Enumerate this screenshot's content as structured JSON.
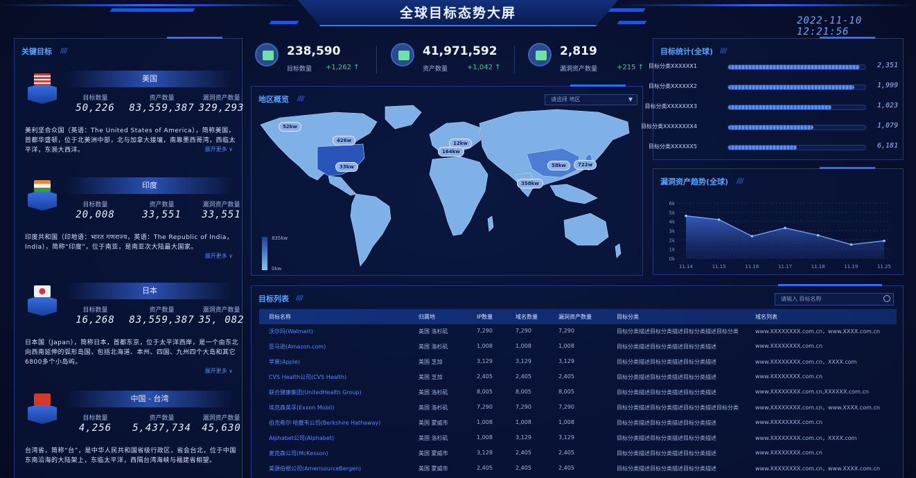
{
  "header": {
    "title": "全球目标态势大屏",
    "datetime": "2022-11-10  12:21:56"
  },
  "left_panel": {
    "title": "关键目标",
    "targets": [
      {
        "name": "美国",
        "flag_color": "#b8413f",
        "labels": [
          "目标数量",
          "资产数量",
          "漏洞资产数量"
        ],
        "values": [
          "50,226",
          "83,559,387",
          "329,293"
        ],
        "desc": "美利坚合众国（英语：The United States of America），简称美国，首都华盛顿，位于北美洲中部，北与加拿大接壤，南靠墨西哥湾，西临太平洋，东濒大西洋。",
        "more": "展开更多 ∨"
      },
      {
        "name": "印度",
        "flag_color": "#e08a3a",
        "labels": [
          "目标数量",
          "资产数量",
          "漏洞资产数量"
        ],
        "values": [
          "20,008",
          "33,551",
          "33,551"
        ],
        "desc": "印度共和国（印地语：भारत गणराज्य，英语：The Republic of India，India），简称“印度”，位于南亚，是南亚次大陆最大国家。",
        "more": "展开更多 ∨"
      },
      {
        "name": "日本",
        "flag_color": "#cfd6e6",
        "labels": [
          "目标数量",
          "资产数量",
          "漏洞资产数量"
        ],
        "values": [
          "16,268",
          "83,559,387",
          "35, 082"
        ],
        "desc": "日本国（Japan），简称日本，首都东京，位于太平洋西岸，是一个由东北向西南延伸的弧形岛国，包括北海道、本州、四国、九州四个大岛和其它6800多个小岛屿。",
        "more": "展开更多 ∨"
      },
      {
        "name": "中国 - 台湾",
        "flag_color": "#d23a2c",
        "labels": [
          "目标数量",
          "资产数量",
          "漏洞资产数量"
        ],
        "values": [
          "4,256",
          "5,437,734",
          "45,630"
        ],
        "desc": "台湾省，简称“台”，是中华人民共和国省级行政区，省会台北，位于中国东南沿海的大陆架上，东临太平洋，西隔台湾海峡与福建省相望。",
        "more": ""
      }
    ]
  },
  "kpis": [
    {
      "value": "238,590",
      "label": "目标数量",
      "delta": "+1,262 ↑",
      "icon": "target-icon"
    },
    {
      "value": "41,971,592",
      "label": "资产数量",
      "delta": "+1,042 ↑",
      "icon": "asset-icon"
    },
    {
      "value": "2,819",
      "label": "漏洞资产数量",
      "delta": "+215 ↑",
      "icon": "vuln-icon"
    }
  ],
  "map": {
    "title": "地区概览",
    "select_placeholder": "请选择 地区",
    "legend_max": "835kw",
    "legend_min": "0kw",
    "pins": [
      "52kw",
      "426w",
      "12kw",
      "33kw",
      "164kw",
      "12kw",
      "58kw",
      "722w",
      "358kw"
    ],
    "colors": {
      "base": "#7fb0e8",
      "mid": "#4d7dd2",
      "dark": "#2a55b8"
    }
  },
  "target_stats": {
    "title": "目标统计(全球)",
    "rows": [
      {
        "label": "目标分类XXXXXX1",
        "value": "2,351",
        "fraction": 0.96
      },
      {
        "label": "目标分类XXXXXX2",
        "value": "1,999",
        "fraction": 0.92
      },
      {
        "label": "目标分类XXXXXXX3",
        "value": "1,023",
        "fraction": 0.75
      },
      {
        "label": "目标分类XXXXXXXX4",
        "value": "1,079",
        "fraction": 0.62
      },
      {
        "label": "目标分类XXXXXX5",
        "value": "6,181",
        "fraction": 0.5
      }
    ]
  },
  "trend": {
    "title": "漏洞资产趋势(全球)",
    "chart_data": {
      "type": "area",
      "x": [
        "11.14",
        "11.15",
        "11.16",
        "11.17",
        "11.18",
        "11.19",
        "11.25"
      ],
      "y_ticks": [
        "6k",
        "5k",
        "4k",
        "3k",
        "2k",
        "1k",
        "0k"
      ],
      "values": [
        4.6,
        4.2,
        2.4,
        3.3,
        2.5,
        1.5,
        1.9
      ],
      "ylim": [
        0,
        6
      ]
    }
  },
  "table": {
    "title": "目标列表",
    "search_placeholder": "请输入 目标名称",
    "columns": [
      "目标名称",
      "归属地",
      "IP数量",
      "域名数量",
      "漏洞资产数量",
      "目标分类",
      "域名列表"
    ],
    "rows": [
      [
        "沃尔玛(Walmart)",
        "美国 洛杉矶",
        "7,290",
        "7,290",
        "7,290",
        "目标分类描述目标分类描述目标分类描述目标分类",
        "www.XXXXXXXX.com.cn，www.XXXX.com.cn"
      ],
      [
        "亚马逊(Amazon.com)",
        "美国 洛杉矶",
        "1,008",
        "1,008",
        "1,008",
        "目标分类描述目标分类描述目标分类描述",
        "www.XXXXXXXX.com.cn"
      ],
      [
        "苹果(Apple)",
        "美国 芝加",
        "3,129",
        "3,129",
        "3,129",
        "目标分类描述目标分类描述目标分类描述",
        "www.XXXXXXXX.com.cn，XXXX.com"
      ],
      [
        "CVS Health公司(CVS Health)",
        "美国 芝加",
        "2,405",
        "2,405",
        "2,405",
        "目标分类描述目标分类描述目标分类描述",
        "www.XXXXXXXX.com.cn"
      ],
      [
        "联合健康集团(UnitedHealth Group)",
        "美国 洛杉矶",
        "8,005",
        "8,005",
        "8,005",
        "目标分类描述目标分类描述目标分类描述",
        "www.XXXXXXXX.com.cn,XXXXXX.com.cn"
      ],
      [
        "埃克森美孚(Exxon Mobil)",
        "美国 洛杉矶",
        "7,290",
        "7,290",
        "7,290",
        "目标分类描述目标分类描述目标分类描述目标分类",
        "www.XXXXXXXX.com.cn，www.XXXX.com.cn"
      ],
      [
        "伯克希尔·哈撒韦公司(Berkshire Hathaway)",
        "美国 蒙威市",
        "1,008",
        "1,008",
        "1,008",
        "目标分类描述目标分类描述目标分类描述",
        "www.XXXXXXXX.com.cn"
      ],
      [
        "Alphabet公司(Alphabet)",
        "美国 洛杉矶",
        "1,008",
        "3,129",
        "3,129",
        "目标分类描述目标分类描述目标分类描述",
        "www.XXXXXXXX.com.cn，XXXX.com"
      ],
      [
        "麦克森公司(McKesson)",
        "美国 蒙威市",
        "3,128",
        "2,405",
        "2,405",
        "目标分类描述目标分类描述目标分类描述",
        "www.XXXXXXXX.com.cn"
      ],
      [
        "美源伯根公司(AmerisourceBergen)",
        "美国 蒙威市",
        "2,405",
        "2,405",
        "2,405",
        "目标分类描述目标分类描述目标分类描述",
        "www.XXXXXXXX.com.cn，www.XXXX.com.cn"
      ]
    ]
  }
}
